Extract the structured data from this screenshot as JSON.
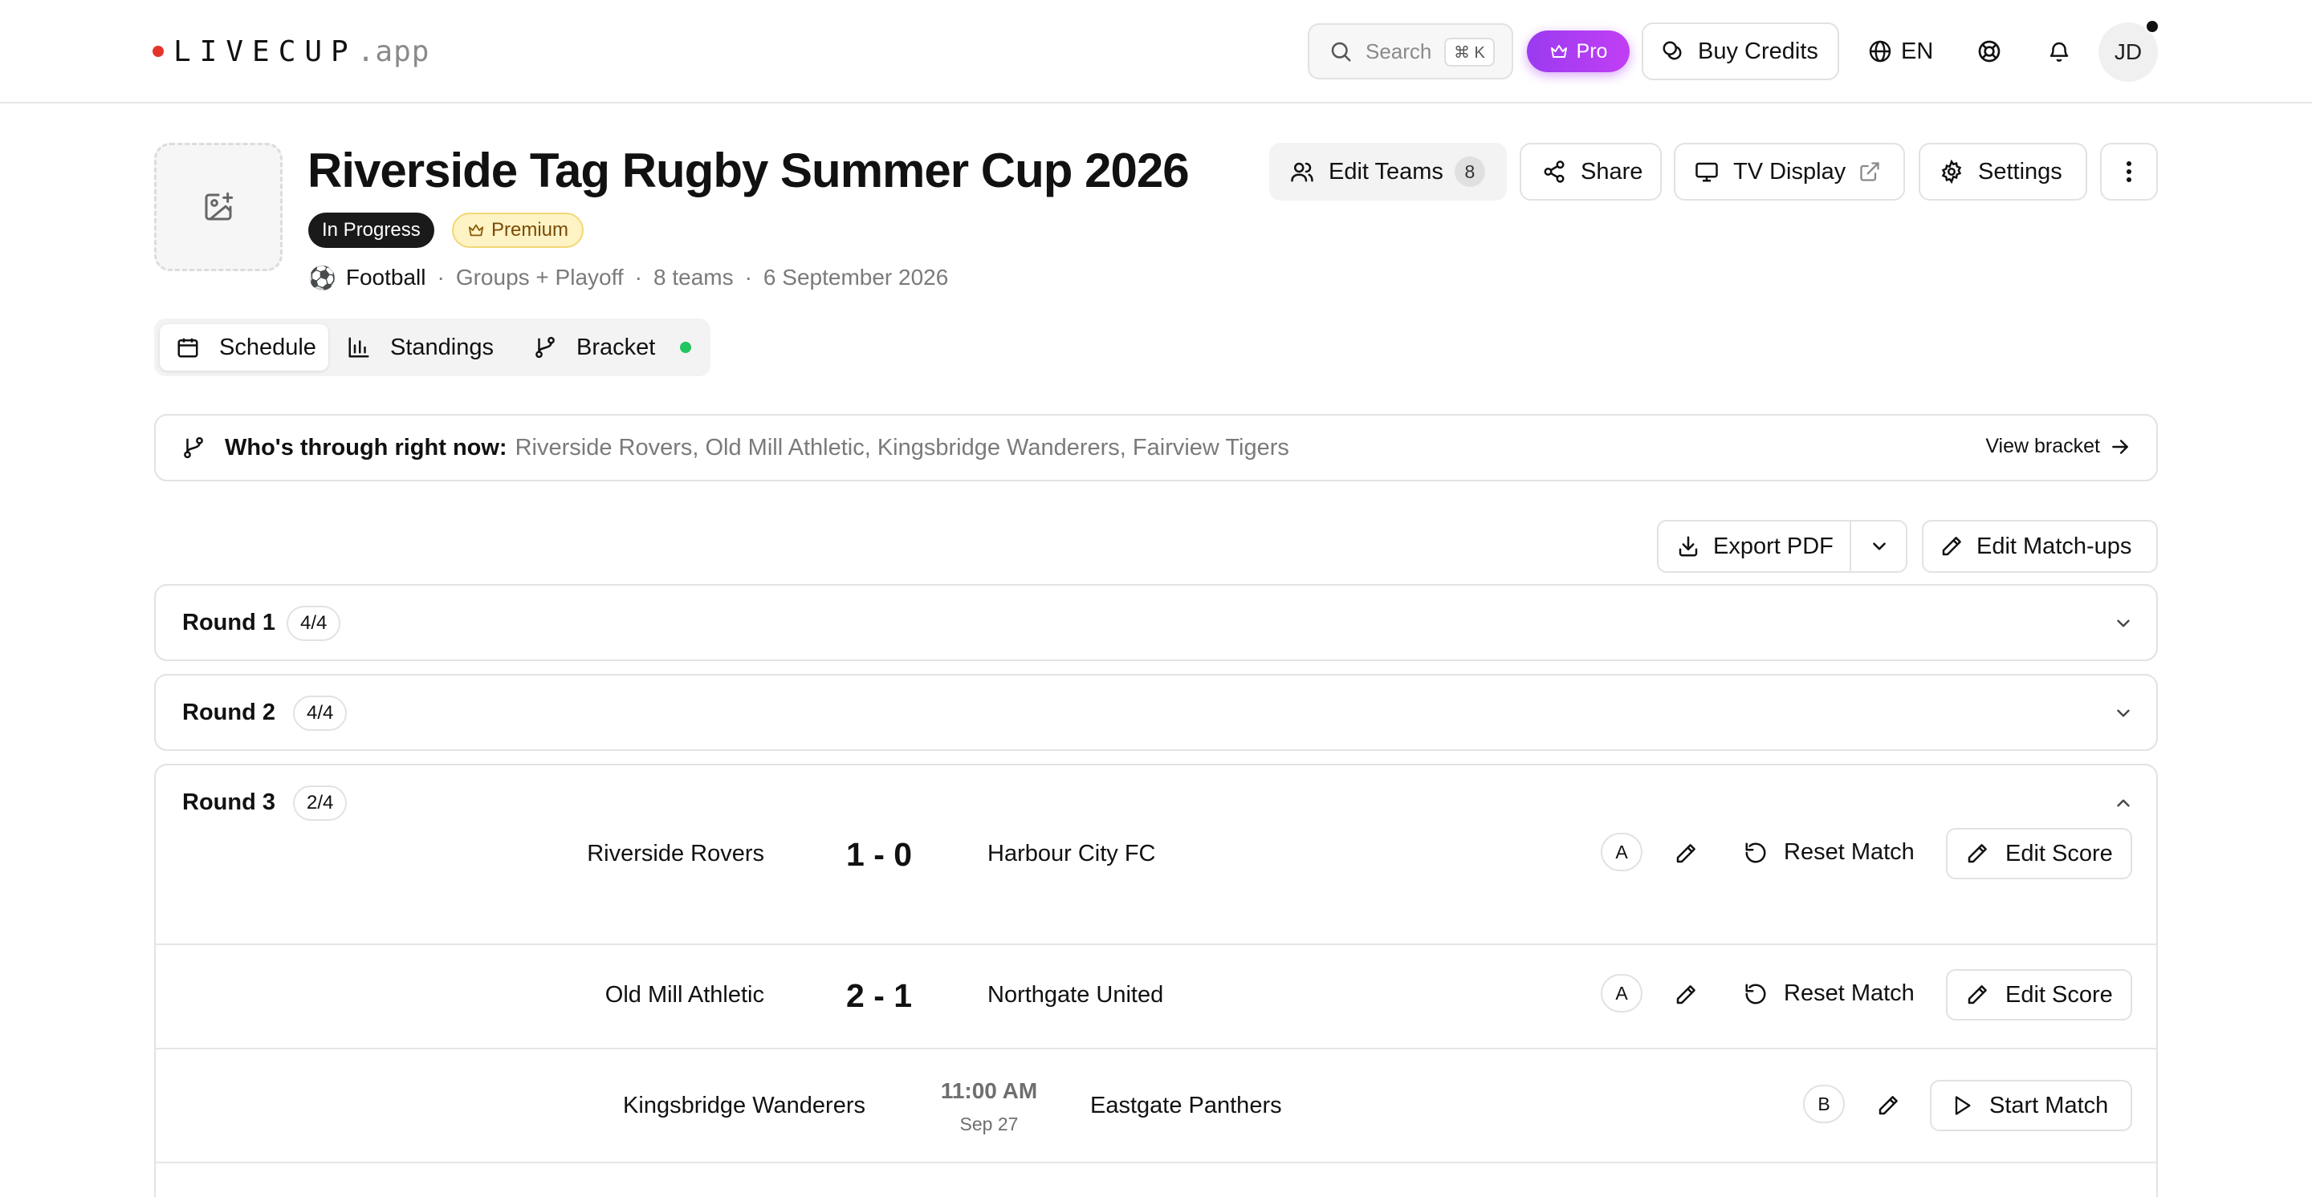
{
  "app": {
    "logo_text": "LIVECUP",
    "logo_suffix": ".app",
    "brand_dot_color": "#e5332a"
  },
  "header": {
    "search_placeholder": "Search",
    "search_shortcut": "⌘ K",
    "pro_label": "Pro",
    "buy_credits_label": "Buy Credits",
    "language": "EN",
    "avatar_initials": "JD"
  },
  "tournament": {
    "title": "Riverside Tag Rugby Summer Cup 2026",
    "status_badge": "In Progress",
    "premium_badge": "Premium",
    "sport_emoji": "⚽",
    "sport": "Football",
    "format": "Groups + Playoff",
    "team_count": "8 teams",
    "date": "6 September 2026",
    "separator": "·"
  },
  "actions": {
    "edit_teams_label": "Edit Teams",
    "edit_teams_count": "8",
    "share_label": "Share",
    "tv_display_label": "TV Display",
    "settings_label": "Settings"
  },
  "tabs": [
    {
      "label": "Schedule",
      "active": true
    },
    {
      "label": "Standings",
      "active": false
    },
    {
      "label": "Bracket",
      "active": false
    }
  ],
  "through": {
    "label": "Who's through right now:",
    "teams": "Riverside Rovers, Old Mill Athletic, Kingsbridge Wanderers, Fairview Tigers",
    "link_label": "View bracket"
  },
  "toolbar": {
    "export_label": "Export PDF",
    "edit_matchups_label": "Edit Match-ups"
  },
  "rounds": [
    {
      "title": "Round 1",
      "count": "4/4",
      "expanded": false
    },
    {
      "title": "Round 2",
      "count": "4/4",
      "expanded": false
    },
    {
      "title": "Round 3",
      "count": "2/4",
      "expanded": true
    }
  ],
  "matches": [
    {
      "home": "Riverside Rovers",
      "score": "1 - 0",
      "away": "Harbour City FC",
      "group": "A",
      "reset_label": "Reset Match",
      "action_label": "Edit Score"
    },
    {
      "home": "Old Mill Athletic",
      "score": "2 - 1",
      "away": "Northgate United",
      "group": "A",
      "reset_label": "Reset Match",
      "action_label": "Edit Score"
    },
    {
      "home": "Kingsbridge Wanderers",
      "time": "11:00 AM",
      "date": "Sep 27",
      "away": "Eastgate Panthers",
      "group": "B",
      "action_label": "Start Match"
    }
  ],
  "colors": {
    "pro_gradient_start": "#9b3bf0",
    "pro_gradient_end": "#c13ef4",
    "status_live": "#22c55e",
    "premium_bg": "#fdf3c4"
  }
}
